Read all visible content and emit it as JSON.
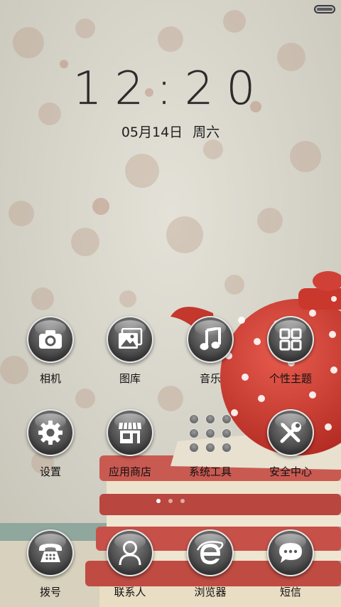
{
  "lockscreen": {
    "time": "12:20",
    "date": "05月14日",
    "weekday": "周六"
  },
  "status_bar": {
    "battery_icon": "battery-icon"
  },
  "apps": [
    {
      "label": "相机",
      "icon": "camera-icon"
    },
    {
      "label": "图库",
      "icon": "gallery-icon"
    },
    {
      "label": "音乐",
      "icon": "music-note-icon"
    },
    {
      "label": "个性主题",
      "icon": "theme-grid-icon"
    },
    {
      "label": "设置",
      "icon": "gear-icon"
    },
    {
      "label": "应用商店",
      "icon": "store-icon"
    },
    {
      "label": "系统工具",
      "icon": "folder-icon"
    },
    {
      "label": "安全中心",
      "icon": "tools-icon"
    }
  ],
  "dock": [
    {
      "label": "拨号",
      "icon": "phone-icon"
    },
    {
      "label": "联系人",
      "icon": "contact-icon"
    },
    {
      "label": "浏览器",
      "icon": "browser-e-icon"
    },
    {
      "label": "短信",
      "icon": "message-icon"
    }
  ],
  "pager": {
    "pages": 3,
    "active": 1
  }
}
